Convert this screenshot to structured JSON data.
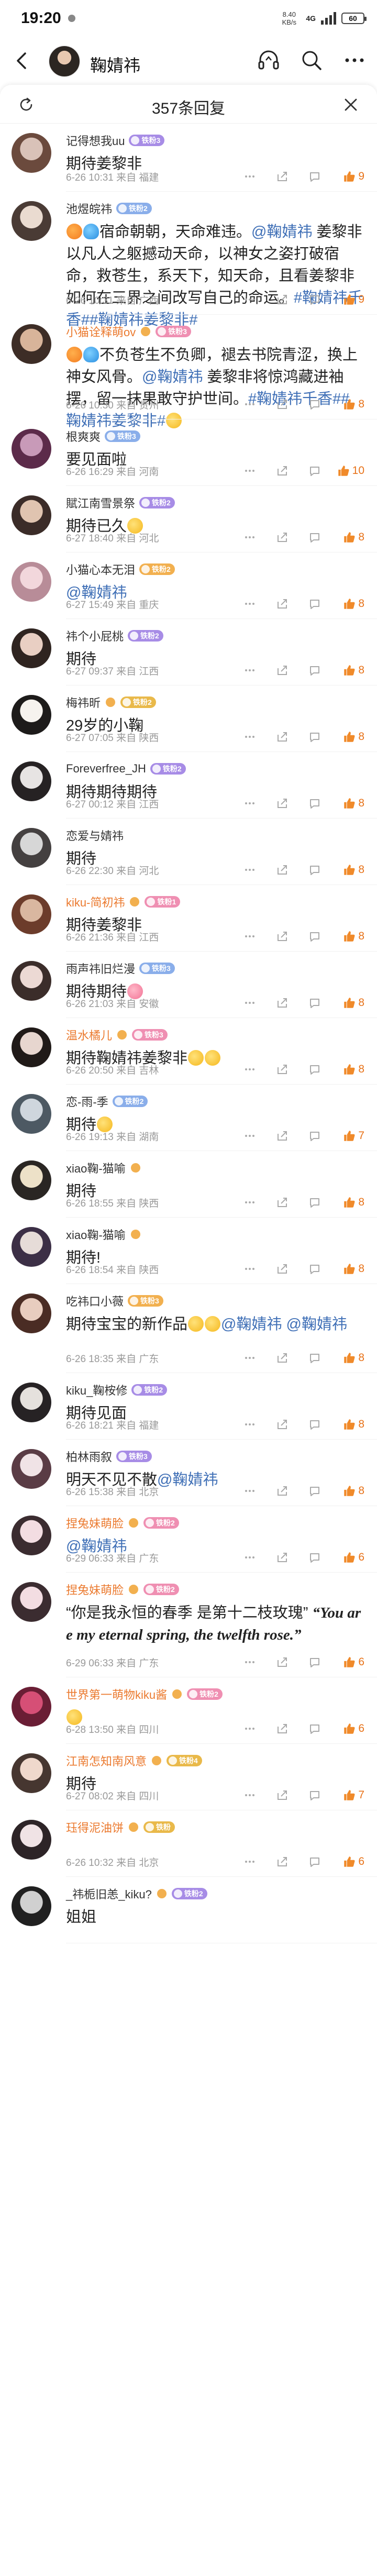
{
  "status_bar": {
    "time": "19:20",
    "net_speed_value": "8.40",
    "net_speed_unit": "KB/s",
    "signal": "4G",
    "battery": "60"
  },
  "nav": {
    "title": "鞠婧祎"
  },
  "sheet": {
    "title": "357条回复"
  },
  "colors": {
    "like_orange": "#e8731a",
    "mention_blue": "#3f6fb6",
    "username_orange": "#eb7a2f",
    "meta_gray": "#999999"
  },
  "comments": [
    {
      "username": "记得想我uu",
      "badge": "铁粉3",
      "badge_color": "purple",
      "text": "期待姜黎非",
      "meta": "6-26 10:31 来自 福建",
      "likes": "9",
      "avatar": [
        "#d9c2b8",
        "#6b4a3d"
      ]
    },
    {
      "username": "池煜皖祎",
      "badge": "铁粉2",
      "badge_color": "blue",
      "text_parts": [
        {
          "t": "e-orange"
        },
        {
          "t": "e-blue"
        },
        {
          "s": "宿命朝朝，天命难违。"
        },
        {
          "m": "@鞠婧祎"
        },
        {
          "s": " 姜黎非以凡人之躯撼动天命，以神女之姿打破宿命，救苍生，系天下，知天命，且看姜黎非如何在三界之间改写自己的命运。"
        },
        {
          "m": "#鞠婧祎千香##鞠婧祎姜黎非#"
        }
      ],
      "meta": "6-26 10:31 来自 广西",
      "likes": "9",
      "avatar": [
        "#eadbd0",
        "#4a3b35"
      ]
    },
    {
      "username": "小猫诠释萌ov",
      "username_orange": true,
      "badge": "铁粉3",
      "badge_color": "pink",
      "extra_badge": true,
      "text_parts": [
        {
          "t": "e-orange"
        },
        {
          "t": "e-blue"
        },
        {
          "s": "不负苍生不负卿，褪去书院青涩，换上神女风骨。"
        },
        {
          "m": "@鞠婧祎"
        },
        {
          "s": " 姜黎非将惊鸿藏进袖摆，留一抹果敢守护世间。"
        },
        {
          "m": "#鞠婧祎千香##鞠婧祎姜黎非#"
        },
        {
          "t": "e-yellow"
        }
      ],
      "meta": "6-26 10:30 来自 贵州",
      "likes": "8",
      "avatar": [
        "#d8b49a",
        "#3d2d26"
      ]
    },
    {
      "username": "根爽爽",
      "badge": "铁粉3",
      "badge_color": "blue",
      "text": "要见面啦",
      "meta": "6-26 16:29 来自 河南",
      "likes": "10",
      "avatar": [
        "#c89ab8",
        "#5c2b4a"
      ]
    },
    {
      "username": "賦江南雪景祭",
      "badge": "铁粉2",
      "badge_color": "purple",
      "text_parts": [
        {
          "s": "期待已久"
        },
        {
          "t": "e-yellow"
        }
      ],
      "meta": "6-27 18:40 来自 河北",
      "likes": "8",
      "avatar": [
        "#e0c4b0",
        "#3b2c28"
      ]
    },
    {
      "username": "小猫心本无泪",
      "badge": "铁粉2",
      "badge_color": "orange",
      "text_parts": [
        {
          "m": "@鞠婧祎"
        }
      ],
      "meta": "6-27 15:49 来自 重庆",
      "likes": "8",
      "avatar": [
        "#f2d7dc",
        "#b88c98"
      ]
    },
    {
      "username": "祎个小屁桃",
      "badge": "铁粉2",
      "badge_color": "purple",
      "text": "期待",
      "meta": "6-27 09:37 来自 江西",
      "likes": "8",
      "avatar": [
        "#e9cfc3",
        "#2f2420"
      ]
    },
    {
      "username": "梅祎昕",
      "badge": "铁粉2",
      "badge_color": "gold",
      "extra_badge": true,
      "text": "29岁的小鞠",
      "meta": "6-27 07:05 来自 陕西",
      "likes": "8",
      "avatar": [
        "#f6f3ee",
        "#1d1b1a"
      ]
    },
    {
      "username": "Foreverfree_JH",
      "badge": "铁粉2",
      "badge_color": "purple",
      "text": "期待期待期待",
      "meta": "6-27 00:12 来自 江西",
      "likes": "8",
      "avatar": [
        "#e7e4e3",
        "#262223"
      ]
    },
    {
      "username": "恋爱与婧祎",
      "badge": "",
      "badge_color": "",
      "text": "期待",
      "meta": "6-26 22:30 来自 河北",
      "likes": "8",
      "avatar": [
        "#d7d7d7",
        "#444040"
      ]
    },
    {
      "username": "kiku-简初祎",
      "username_orange": true,
      "badge": "铁粉1",
      "badge_color": "pink",
      "extra_badge": true,
      "text": "期待姜黎非",
      "meta": "6-26 21:36 来自 江西",
      "likes": "8",
      "avatar": [
        "#d9b7a0",
        "#6c3c2b"
      ]
    },
    {
      "username": "雨声祎旧烂漫",
      "badge": "铁粉3",
      "badge_color": "blue",
      "text_parts": [
        {
          "s": "期待期待"
        },
        {
          "t": "e-pink"
        }
      ],
      "meta": "6-26 21:03 来自 安徽",
      "likes": "8",
      "avatar": [
        "#ecd9d4",
        "#3b2d2a"
      ]
    },
    {
      "username": "温水橘儿",
      "username_orange": true,
      "badge": "铁粉3",
      "badge_color": "pink",
      "extra_badge": true,
      "text_parts": [
        {
          "s": "期待鞠婧祎姜黎非"
        },
        {
          "t": "e-yellow"
        },
        {
          "t": "e-yellow"
        }
      ],
      "meta": "6-26 20:50 来自 吉林",
      "likes": "8",
      "avatar": [
        "#e7d6cf",
        "#201a18"
      ]
    },
    {
      "username": "恋-雨-季",
      "badge": "铁粉2",
      "badge_color": "blue",
      "text_parts": [
        {
          "s": "期待"
        },
        {
          "t": "e-yellow"
        }
      ],
      "meta": "6-26 19:13 来自 湖南",
      "likes": "7",
      "avatar": [
        "#cfd6dd",
        "#4d5963"
      ]
    },
    {
      "username": "xiao鞠-猫喻",
      "badge": "",
      "badge_color": "",
      "extra_badge": true,
      "text": "期待",
      "meta": "6-26 18:55 来自 陕西",
      "likes": "8",
      "avatar": [
        "#ede1c8",
        "#2a2623"
      ]
    },
    {
      "username": "xiao鞠-猫喻",
      "badge": "",
      "badge_color": "",
      "extra_badge": true,
      "text": "期待!",
      "meta": "6-26 18:54 来自 陕西",
      "likes": "8",
      "avatar": [
        "#e6dcd8",
        "#3c2f46"
      ]
    },
    {
      "username": "吃祎口小薇",
      "badge": "铁粉3",
      "badge_color": "orange",
      "text_parts": [
        {
          "s": "期待宝宝的新作品"
        },
        {
          "t": "e-yellow"
        },
        {
          "t": "e-yellow"
        },
        {
          "m": "@鞠婧祎"
        },
        {
          "s": " "
        },
        {
          "m": "@鞠婧祎"
        }
      ],
      "meta": "6-26 18:35 来自 广东",
      "likes": "8",
      "avatar": [
        "#e8cdbf",
        "#4a2c24"
      ]
    },
    {
      "username": "kiku_鞠桉修",
      "badge": "铁粉2",
      "badge_color": "purple",
      "text": "期待见面",
      "meta": "6-26 18:21 来自 福建",
      "likes": "8",
      "avatar": [
        "#e5e1dd",
        "#262224"
      ]
    },
    {
      "username": "柏林雨叙",
      "badge": "铁粉3",
      "badge_color": "purple",
      "text_parts": [
        {
          "s": "明天不见不散"
        },
        {
          "m": "@鞠婧祎"
        }
      ],
      "meta": "6-26 15:38 来自 北京",
      "likes": "8",
      "avatar": [
        "#f0e3e6",
        "#5a3c45"
      ]
    },
    {
      "username": "捏兔妹萌脸",
      "username_orange": true,
      "badge": "铁粉2",
      "badge_color": "pink",
      "extra_badge": true,
      "text_parts": [
        {
          "m": "@鞠婧祎"
        }
      ],
      "meta": "6-29 06:33 来自 广东",
      "likes": "6",
      "avatar": [
        "#f3dde2",
        "#3b2c30"
      ]
    },
    {
      "username": "捏兔妹萌脸",
      "username_orange": true,
      "badge": "铁粉2",
      "badge_color": "pink",
      "extra_badge": true,
      "text_parts": [
        {
          "s": "“你是我永恒的春季 是第十二枝玫瑰” "
        },
        {
          "i": "“You are my eternal spring, the twelfth rose.”"
        }
      ],
      "meta": "6-29 06:33 来自 广东",
      "likes": "6",
      "avatar": [
        "#f3dde2",
        "#3b2c30"
      ]
    },
    {
      "username": "世界第一萌物kiku酱",
      "username_orange": true,
      "badge": "铁粉2",
      "badge_color": "pink",
      "extra_badge": true,
      "text_parts": [
        {
          "t": "e-yellow"
        }
      ],
      "meta": "6-28 13:50 来自 四川",
      "likes": "6",
      "avatar": [
        "#d64f76",
        "#6a1e35"
      ]
    },
    {
      "username": "江南怎知南风意",
      "username_orange": true,
      "badge": "铁粉4",
      "badge_color": "gold",
      "extra_badge": true,
      "text": "期待",
      "meta": "6-27 08:02 来自 四川",
      "likes": "7",
      "avatar": [
        "#efd8cc",
        "#463630"
      ]
    },
    {
      "username": "珏得泥油饼",
      "username_orange": true,
      "badge": "铁粉",
      "badge_color": "gold",
      "extra_badge": true,
      "text": "",
      "meta": "6-26 10:32 来自 北京",
      "likes": "6",
      "avatar": [
        "#f0e3e5",
        "#2d2427"
      ]
    },
    {
      "username": "_祎栀旧恙_kiku?",
      "badge": "铁粉2",
      "badge_color": "purple",
      "extra_badge": true,
      "text": "姐姐",
      "meta": "",
      "likes": "",
      "avatar": [
        "#d0d0d0",
        "#202020"
      ]
    }
  ]
}
